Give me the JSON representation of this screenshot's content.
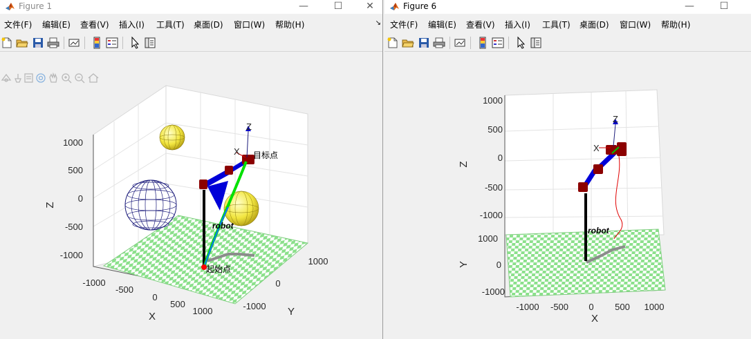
{
  "windows": [
    {
      "title": "Figure 1",
      "menus": [
        "文件(F)",
        "编辑(E)",
        "查看(V)",
        "插入(I)",
        "工具(T)",
        "桌面(D)",
        "窗口(W)",
        "帮助(H)"
      ],
      "menu_overflow": "↘",
      "controls": {
        "minimize": "—",
        "maximize": "☐",
        "close": "✕"
      },
      "toolbar_icons": [
        "new-figure-icon",
        "open-file-icon",
        "save-icon",
        "print-icon",
        "link-plot-icon",
        "colorbar-icon",
        "legend-icon",
        "edit-plot-icon",
        "property-inspector-icon"
      ],
      "axes_toolbar_icons": [
        "data-tips-icon",
        "brush-icon",
        "export-icon",
        "rotate-3d-icon",
        "pan-icon",
        "zoom-in-icon",
        "zoom-out-icon",
        "home-icon"
      ],
      "plot": {
        "z_ticks": [
          "1000",
          "500",
          "0",
          "-500",
          "-1000"
        ],
        "x_ticks": [
          "-1000",
          "-500",
          "0",
          "500",
          "1000"
        ],
        "y_ticks": [
          "1000",
          "0",
          "-1000"
        ],
        "xlabel": "X",
        "ylabel": "Y",
        "zlabel": "Z",
        "annotations": {
          "target": "目标点",
          "start": "起始点",
          "robot": "robot"
        },
        "frame_labels": {
          "z": "Z",
          "x": "X"
        }
      }
    },
    {
      "title": "Figure 6",
      "menus": [
        "文件(F)",
        "编辑(E)",
        "查看(V)",
        "插入(I)",
        "工具(T)",
        "桌面(D)",
        "窗口(W)",
        "帮助(H)"
      ],
      "controls": {
        "minimize": "—",
        "maximize": "☐"
      },
      "toolbar_icons": [
        "new-figure-icon",
        "open-file-icon",
        "save-icon",
        "print-icon",
        "link-plot-icon",
        "colorbar-icon",
        "legend-icon",
        "edit-plot-icon",
        "property-inspector-icon"
      ],
      "plot": {
        "z_ticks": [
          "1000",
          "500",
          "0",
          "-500",
          "-1000"
        ],
        "y_ticks": [
          "1000",
          "0",
          "-1000"
        ],
        "x_ticks": [
          "-1000",
          "-500",
          "0",
          "500",
          "1000"
        ],
        "xlabel": "X",
        "ylabel": "Y",
        "zlabel": "Z",
        "annotations": {
          "robot": "robot"
        },
        "frame_labels": {
          "z": "Z",
          "x": "X"
        }
      }
    }
  ],
  "colors": {
    "floor_green": "#8be08b",
    "link_blue": "#0000d8",
    "joint_red": "#8b0000",
    "trajectory_green": "#00e000",
    "trajectory_red": "#e00000",
    "sphere_yellow": "#f2e640",
    "sphere_wire_blue": "#1a1a7a",
    "shadow_gray": "#8c8c8c"
  }
}
